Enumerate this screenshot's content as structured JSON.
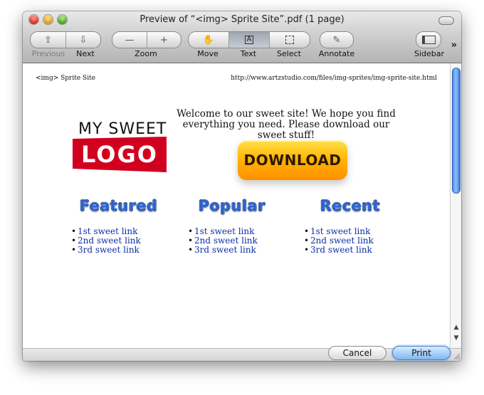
{
  "window": {
    "title": "Preview of “<img> Sprite Site”.pdf (1 page)"
  },
  "toolbar": {
    "labels": {
      "previous": "Previous",
      "next": "Next",
      "zoom": "Zoom",
      "move": "Move",
      "text": "Text",
      "select": "Select",
      "annotate": "Annotate",
      "sidebar": "Sidebar"
    },
    "icons": {
      "previous": "arrow-up-icon",
      "next": "arrow-down-icon",
      "zoom_out": "minus-icon",
      "zoom_in": "plus-icon",
      "move": "hand-icon",
      "text": "text-tool-icon",
      "select": "selection-icon",
      "annotate": "pencil-icon",
      "sidebar": "sidebar-icon",
      "overflow": "double-chevron-icon"
    },
    "overflow": "»"
  },
  "document": {
    "header_left": "<img> Sprite Site",
    "header_right": "http://www.artzstudio.com/files/img-sprites/img-sprite-site.html",
    "logo": {
      "line1": "MY SWEET",
      "line2": "LOGO"
    },
    "welcome": "Welcome to our sweet site! We hope you find everything you need. Please download our sweet stuff!",
    "download_label": "DOWNLOAD",
    "columns": [
      {
        "title": "Featured",
        "links": [
          "1st sweet link",
          "2nd sweet link",
          "3rd sweet link"
        ]
      },
      {
        "title": "Popular",
        "links": [
          "1st sweet link",
          "2nd sweet link",
          "3rd sweet link"
        ]
      },
      {
        "title": "Recent",
        "links": [
          "1st sweet link",
          "2nd sweet link",
          "3rd sweet link"
        ]
      }
    ]
  },
  "buttons": {
    "cancel": "Cancel",
    "print": "Print"
  }
}
